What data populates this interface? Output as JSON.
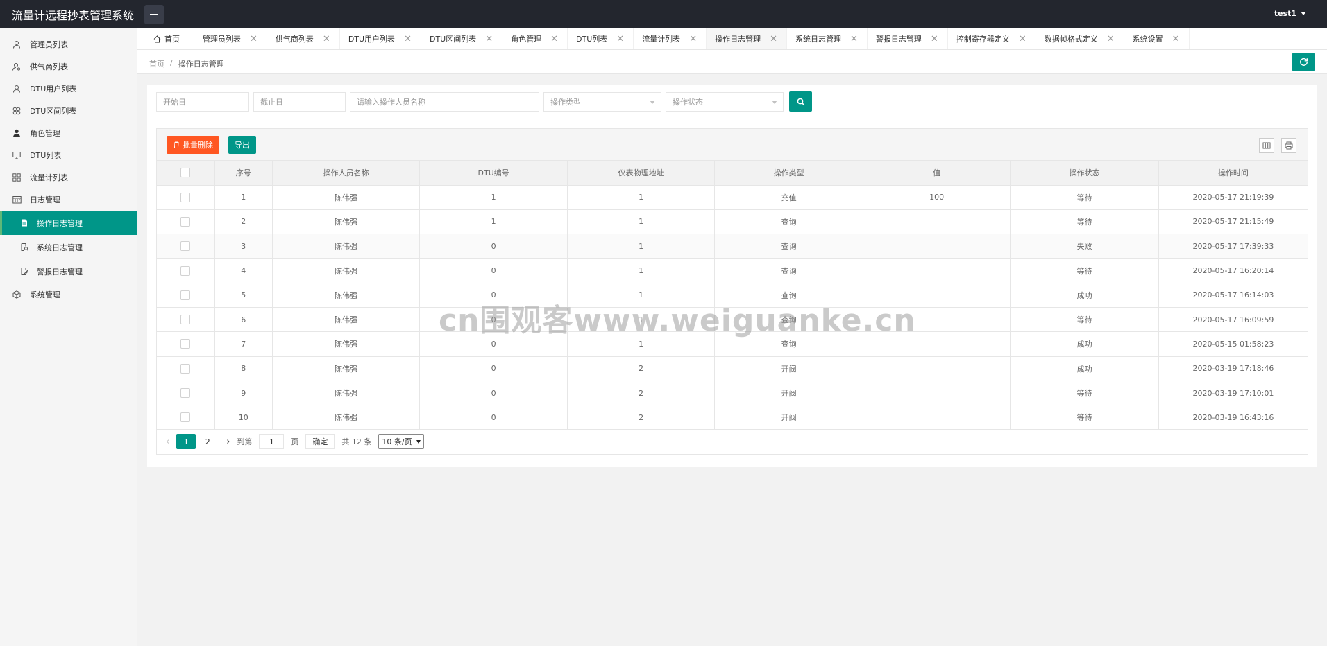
{
  "header": {
    "app_title": "流量计远程抄表管理系统",
    "user": "test1"
  },
  "sidebar": {
    "items": [
      {
        "label": "管理员列表",
        "icon": "user-icon"
      },
      {
        "label": "供气商列表",
        "icon": "user-gear-icon"
      },
      {
        "label": "DTU用户列表",
        "icon": "user-icon"
      },
      {
        "label": "DTU区间列表",
        "icon": "cluster-icon"
      },
      {
        "label": "角色管理",
        "icon": "person-solid-icon"
      },
      {
        "label": "DTU列表",
        "icon": "monitor-icon"
      },
      {
        "label": "流量计列表",
        "icon": "grid-icon"
      },
      {
        "label": "日志管理",
        "icon": "calendar-icon"
      }
    ],
    "sub_items": [
      {
        "label": "操作日志管理",
        "icon": "doc-icon",
        "active": true
      },
      {
        "label": "系统日志管理",
        "icon": "doc-search-icon"
      },
      {
        "label": "警报日志管理",
        "icon": "doc-edit-icon"
      }
    ],
    "last_item": {
      "label": "系统管理",
      "icon": "cube-icon"
    }
  },
  "tabs": [
    {
      "label": "首页"
    },
    {
      "label": "管理员列表"
    },
    {
      "label": "供气商列表"
    },
    {
      "label": "DTU用户列表"
    },
    {
      "label": "DTU区间列表"
    },
    {
      "label": "角色管理"
    },
    {
      "label": "DTU列表"
    },
    {
      "label": "流量计列表"
    },
    {
      "label": "操作日志管理",
      "active": true
    },
    {
      "label": "系统日志管理"
    },
    {
      "label": "警报日志管理"
    },
    {
      "label": "控制寄存器定义"
    },
    {
      "label": "数据帧格式定义"
    },
    {
      "label": "系统设置"
    }
  ],
  "breadcrumb": {
    "home": "首页",
    "sep": "/",
    "current": "操作日志管理"
  },
  "search": {
    "start_placeholder": "开始日",
    "end_placeholder": "截止日",
    "name_placeholder": "请输入操作人员名称",
    "type_placeholder": "操作类型",
    "status_placeholder": "操作状态"
  },
  "toolbar": {
    "batch_delete": "批量删除",
    "export": "导出"
  },
  "table": {
    "headers": [
      "序号",
      "操作人员名称",
      "DTU编号",
      "仪表物理地址",
      "操作类型",
      "值",
      "操作状态",
      "操作时间"
    ],
    "rows": [
      [
        "1",
        "陈伟强",
        "1",
        "1",
        "充值",
        "100",
        "等待",
        "2020-05-17 21:19:39"
      ],
      [
        "2",
        "陈伟强",
        "1",
        "1",
        "查询",
        "",
        "等待",
        "2020-05-17 21:15:49"
      ],
      [
        "3",
        "陈伟强",
        "0",
        "1",
        "查询",
        "",
        "失败",
        "2020-05-17 17:39:33"
      ],
      [
        "4",
        "陈伟强",
        "0",
        "1",
        "查询",
        "",
        "等待",
        "2020-05-17 16:20:14"
      ],
      [
        "5",
        "陈伟强",
        "0",
        "1",
        "查询",
        "",
        "成功",
        "2020-05-17 16:14:03"
      ],
      [
        "6",
        "陈伟强",
        "0",
        "1",
        "查询",
        "",
        "等待",
        "2020-05-17 16:09:59"
      ],
      [
        "7",
        "陈伟强",
        "0",
        "1",
        "查询",
        "",
        "成功",
        "2020-05-15 01:58:23"
      ],
      [
        "8",
        "陈伟强",
        "0",
        "2",
        "开阀",
        "",
        "成功",
        "2020-03-19 17:18:46"
      ],
      [
        "9",
        "陈伟强",
        "0",
        "2",
        "开阀",
        "",
        "等待",
        "2020-03-19 17:10:01"
      ],
      [
        "10",
        "陈伟强",
        "0",
        "2",
        "开阀",
        "",
        "等待",
        "2020-03-19 16:43:16"
      ]
    ]
  },
  "pager": {
    "pages": [
      "1",
      "2"
    ],
    "goto_label": "到第",
    "page_value": "1",
    "page_unit": "页",
    "confirm": "确定",
    "total": "共 12 条",
    "size": "10 条/页"
  },
  "watermark": "cn围观客www.weiguanke.cn",
  "colors": {
    "primary": "#009688",
    "danger": "#ff5722",
    "header_bg": "#23262e"
  }
}
